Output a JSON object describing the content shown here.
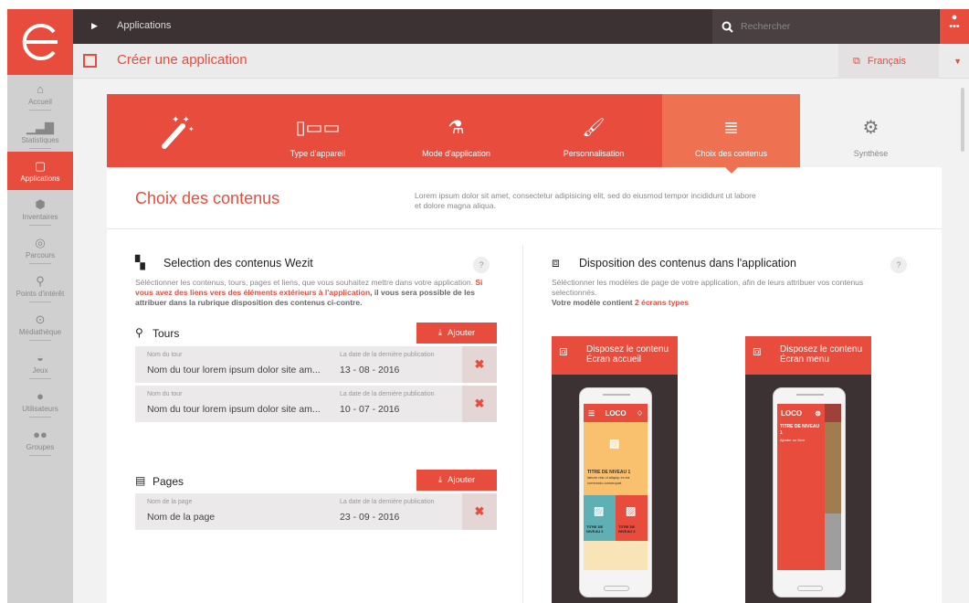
{
  "colors": {
    "accent": "#e74c3c",
    "dark": "#3c3133",
    "active_step": "#ee7152"
  },
  "topbar": {
    "title": "Applications",
    "search_placeholder": "Rechercher"
  },
  "subbar": {
    "title": "Créer une application",
    "language": "Français"
  },
  "sidebar": {
    "items": [
      {
        "label": "Accueil",
        "icon": "home-icon"
      },
      {
        "label": "Statistiques",
        "icon": "stats-icon"
      },
      {
        "label": "Applications",
        "icon": "tablet-icon",
        "active": true
      },
      {
        "label": "Inventaires",
        "icon": "box-icon"
      },
      {
        "label": "Parcours",
        "icon": "compass-icon"
      },
      {
        "label": "Points d'intérêt",
        "icon": "pin-icon"
      },
      {
        "label": "Médiathèque",
        "icon": "play-icon"
      },
      {
        "label": "Jeux",
        "icon": "gamepad-icon"
      },
      {
        "label": "Utilisateurs",
        "icon": "user-icon"
      },
      {
        "label": "Groupes",
        "icon": "group-icon"
      }
    ]
  },
  "steps": [
    {
      "label": "Type d'appareil",
      "icon": "devices-icon"
    },
    {
      "label": "Mode d'application",
      "icon": "flask-icon"
    },
    {
      "label": "Personnalisation",
      "icon": "brush-icon"
    },
    {
      "label": "Choix des contenus",
      "icon": "stack-icon",
      "current": true
    },
    {
      "label": "Synthèse",
      "icon": "gears-icon"
    }
  ],
  "content": {
    "title": "Choix des contenus",
    "description": "Lorem ipsum dolor sit amet, consectetur adipisicing elit, sed do eiusmod tempor incididunt ut labore et dolore magna aliqua."
  },
  "selection": {
    "title": "Selection des contenus Wezit",
    "help": "?",
    "desc_1": "Séléctionner les contenus, tours, pages et liens, que vous souhaitez mettre dans votre application. ",
    "desc_red": "Si vous avez des liens vers des éléments extérieurs à l'application",
    "desc_2": ", il vous sera possible de les attribuer dans la rubrique disposition des contenus ci-contre."
  },
  "tours": {
    "label": "Tours",
    "add": "Ajouter",
    "name_key": "Nom du tour",
    "date_key": "La date de la dernière publication",
    "rows": [
      {
        "name": "Nom du  tour lorem ipsum dolor site am...",
        "date": "13 - 08 - 2016"
      },
      {
        "name": "Nom du  tour lorem ipsum dolor site am...",
        "date": "10 - 07 - 2016"
      }
    ]
  },
  "pages": {
    "label": "Pages",
    "add": "Ajouter",
    "name_key": "Nom de la page",
    "date_key": "La date de la dernière publication",
    "rows": [
      {
        "name": "Nom de la page",
        "date": "23 - 09 - 2016"
      }
    ]
  },
  "disposition": {
    "title": "Disposition des contenus dans l'application",
    "help": "?",
    "desc": "Séléctionner les modèles de page de votre application, afin de leurs attribuer vos contenus selectionnés.",
    "model_text": "Votre modèle contient ",
    "model_red": "2 écrans types",
    "cards": [
      {
        "line1": "Disposez le contenu",
        "line2": "Écran accueil"
      },
      {
        "line1": "Disposez le contenu",
        "line2": "Écran menu"
      }
    ],
    "phone": {
      "brand": "LOCO",
      "title1": "TITRE DE NIVEAU 1",
      "sub1": "labore nisi ut aliquip ex ea commodo consequat.",
      "title2a": "TITRE DE NIVEAU 2",
      "title2b": "TITRE DE NIVEAU 2",
      "menu_title": "TITRE DE NIVEAU 1",
      "menu_item": "Ajouter un Item"
    }
  }
}
